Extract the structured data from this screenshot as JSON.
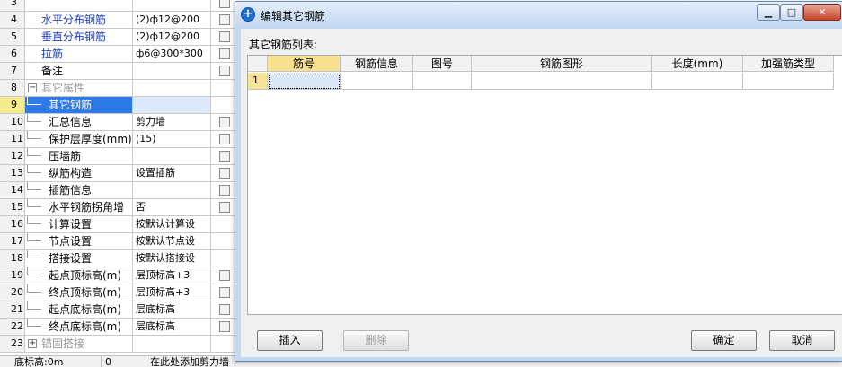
{
  "grid": {
    "rows": [
      {
        "num": "3",
        "name": "",
        "value": "",
        "check": true,
        "style": "blue"
      },
      {
        "num": "4",
        "name": "水平分布钢筋",
        "value": "(2)ф12@200",
        "check": true,
        "style": "blue"
      },
      {
        "num": "5",
        "name": "垂直分布钢筋",
        "value": "(2)ф12@200",
        "check": true,
        "style": "blue"
      },
      {
        "num": "6",
        "name": "拉筋",
        "value": "ф6@300*300",
        "check": true,
        "style": "blue"
      },
      {
        "num": "7",
        "name": "备注",
        "value": "",
        "check": true,
        "style": "plain"
      },
      {
        "num": "8",
        "name": "其它属性",
        "value": "",
        "check": false,
        "style": "group",
        "expander": "−"
      },
      {
        "num": "9",
        "name": "其它钢筋",
        "value": "",
        "check": false,
        "style": "child",
        "selected": true
      },
      {
        "num": "10",
        "name": "汇总信息",
        "value": "剪力墙",
        "check": true,
        "style": "child"
      },
      {
        "num": "11",
        "name": "保护层厚度(mm)",
        "value": "(15)",
        "check": true,
        "style": "child"
      },
      {
        "num": "12",
        "name": "压墙筋",
        "value": "",
        "check": true,
        "style": "child"
      },
      {
        "num": "13",
        "name": "纵筋构造",
        "value": "设置插筋",
        "check": true,
        "style": "child"
      },
      {
        "num": "14",
        "name": "插筋信息",
        "value": "",
        "check": true,
        "style": "child"
      },
      {
        "num": "15",
        "name": "水平钢筋拐角增",
        "value": "否",
        "check": true,
        "style": "child"
      },
      {
        "num": "16",
        "name": "计算设置",
        "value": "按默认计算设",
        "check": false,
        "style": "child"
      },
      {
        "num": "17",
        "name": "节点设置",
        "value": "按默认节点设",
        "check": false,
        "style": "child"
      },
      {
        "num": "18",
        "name": "搭接设置",
        "value": "按默认搭接设",
        "check": false,
        "style": "child"
      },
      {
        "num": "19",
        "name": "起点顶标高(m)",
        "value": "层顶标高+3",
        "check": true,
        "style": "child"
      },
      {
        "num": "20",
        "name": "终点顶标高(m)",
        "value": "层顶标高+3",
        "check": true,
        "style": "child"
      },
      {
        "num": "21",
        "name": "起点底标高(m)",
        "value": "层底标高",
        "check": true,
        "style": "child"
      },
      {
        "num": "22",
        "name": "终点底标高(m)",
        "value": "层底标高",
        "check": true,
        "style": "child"
      },
      {
        "num": "23",
        "name": "锚固搭接",
        "value": "",
        "check": false,
        "style": "group",
        "expander": "+"
      }
    ]
  },
  "statusbar": {
    "left": "底标高:0m",
    "middle": "0",
    "message": "在此处添加剪力墙"
  },
  "dialog": {
    "title": "编辑其它钢筋",
    "app_icon": "plus-circle-icon",
    "list_label": "其它钢筋列表:",
    "columns": [
      "筋号",
      "钢筋信息",
      "图号",
      "钢筋图形",
      "长度(mm)",
      "加强筋类型"
    ],
    "rows": [
      {
        "num": "1",
        "cells": [
          "",
          "",
          "",
          "",
          "",
          ""
        ]
      }
    ],
    "buttons": {
      "insert": "插入",
      "delete": "删除",
      "ok": "确定",
      "cancel": "取消"
    }
  },
  "colors": {
    "selection": "#2e7ae6",
    "header_active": "#f7e08f",
    "link_text": "#1f3fbf"
  }
}
